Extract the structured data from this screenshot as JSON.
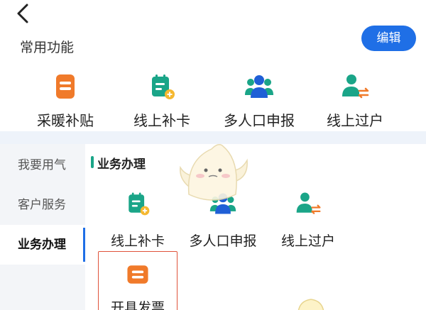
{
  "header": {
    "back_icon": "chevron-left-icon"
  },
  "favorites": {
    "title": "常用功能",
    "edit_label": "编辑",
    "items": [
      {
        "label": "采暖补贴",
        "icon": "heating-subsidy-icon"
      },
      {
        "label": "线上补卡",
        "icon": "card-replace-icon"
      },
      {
        "label": "多人口申报",
        "icon": "multi-person-icon"
      },
      {
        "label": "线上过户",
        "icon": "transfer-icon"
      }
    ]
  },
  "sidebar": {
    "items": [
      {
        "label": "我要用气"
      },
      {
        "label": "客户服务"
      },
      {
        "label": "业务办理"
      }
    ],
    "active_index": 2
  },
  "business": {
    "title": "业务办理",
    "items": [
      {
        "label": "线上补卡",
        "icon": "card-replace-icon"
      },
      {
        "label": "多人口申报",
        "icon": "multi-person-icon"
      },
      {
        "label": "线上过户",
        "icon": "transfer-icon"
      },
      {
        "label": "开具发票",
        "icon": "invoice-icon"
      }
    ]
  },
  "colors": {
    "accent": "#1f6fe6",
    "green": "#1aa588",
    "orange": "#f07a2a",
    "highlight_border": "#e0533a"
  }
}
